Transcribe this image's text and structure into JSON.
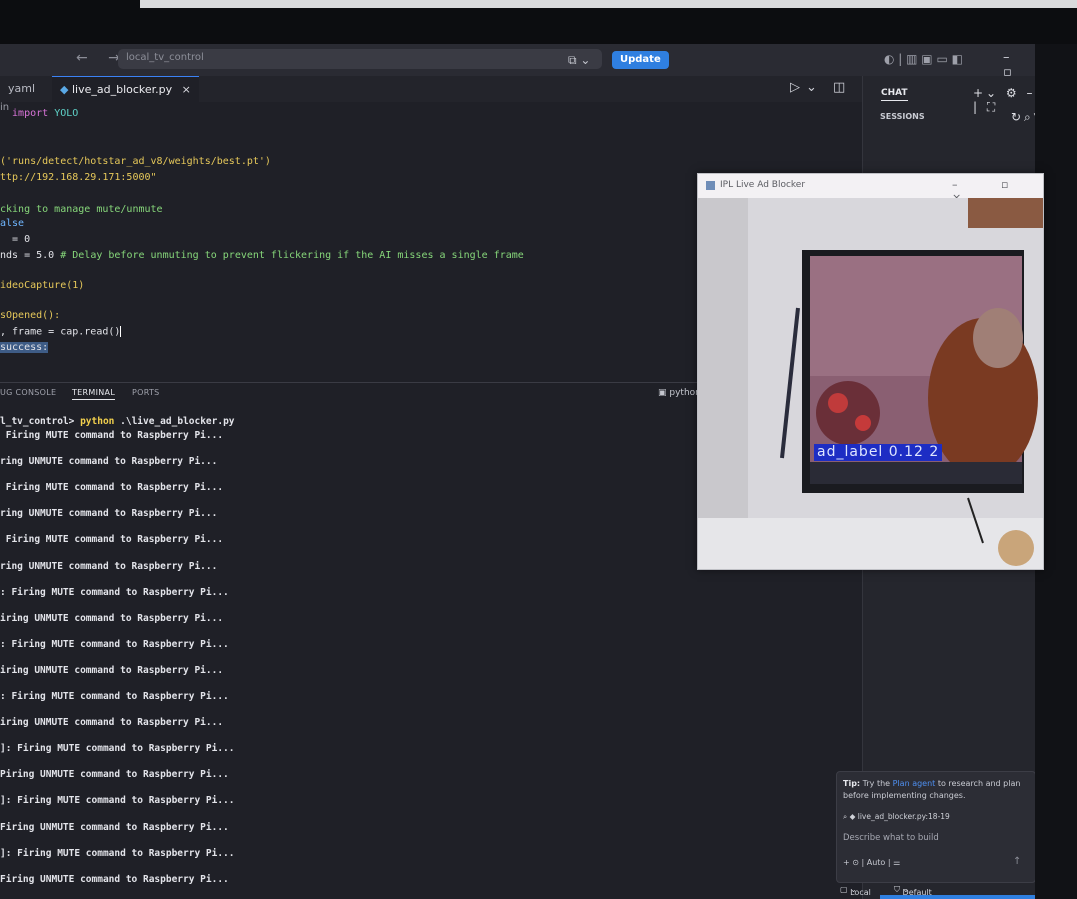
{
  "titlebar": {
    "search_text": "local_tv_control",
    "update_label": "Update"
  },
  "tabs": [
    {
      "label": "yaml"
    },
    {
      "label": "live_ad_blocker.py",
      "close": "×"
    }
  ],
  "breadcrumb": "in",
  "code_lines": [
    {
      "segments": [
        {
          "c": "kw",
          "t": "  import "
        },
        {
          "c": "cls",
          "t": "YOLO"
        }
      ]
    },
    {
      "segments": [
        {
          "c": "yel",
          "t": "('runs/detect/hotstar_ad_v8/weights/best.pt')"
        }
      ]
    },
    {
      "segments": [
        {
          "c": "yel",
          "t": "ttp://192.168.29.171:5000\""
        }
      ]
    },
    {
      "segments": [
        {
          "c": "grn",
          "t": "cking to manage mute/unmute"
        }
      ]
    },
    {
      "segments": [
        {
          "c": "blu",
          "t": "alse"
        }
      ]
    },
    {
      "segments": [
        {
          "c": "wht",
          "t": "  = 0"
        }
      ]
    },
    {
      "segments": [
        {
          "c": "wht",
          "t": "nds = 5.0 "
        },
        {
          "c": "grn",
          "t": "# Delay before unmuting to prevent flickering if the AI misses a single frame"
        }
      ]
    },
    {
      "segments": [
        {
          "c": "yel",
          "t": "ideoCapture(1)"
        }
      ]
    },
    {
      "segments": [
        {
          "c": "yel",
          "t": "sOpened():"
        }
      ]
    },
    {
      "segments": [
        {
          "c": "wht",
          "t": ", frame = cap.read()"
        }
      ]
    },
    {
      "segments": [
        {
          "c": "sel",
          "t": "success:"
        }
      ]
    }
  ],
  "panel": {
    "tabs": [
      "UG CONSOLE",
      "TERMINAL",
      "PORTS"
    ],
    "active_tab": "TERMINAL",
    "shell_label": "python"
  },
  "terminal": {
    "prompt_path": "l_tv_control> ",
    "prompt_cmd": "python",
    "prompt_args": " .\\live_ad_blocker.py",
    "lines": [
      " Firing MUTE command to Raspberry Pi...",
      "ring UNMUTE command to Raspberry Pi...",
      " Firing MUTE command to Raspberry Pi...",
      "ring UNMUTE command to Raspberry Pi...",
      " Firing MUTE command to Raspberry Pi...",
      "ring UNMUTE command to Raspberry Pi...",
      ": Firing MUTE command to Raspberry Pi...",
      "iring UNMUTE command to Raspberry Pi...",
      ": Firing MUTE command to Raspberry Pi...",
      "iring UNMUTE command to Raspberry Pi...",
      ": Firing MUTE command to Raspberry Pi...",
      "iring UNMUTE command to Raspberry Pi...",
      "]: Firing MUTE command to Raspberry Pi...",
      "Piring UNMUTE command to Raspberry Pi...",
      "]: Firing MUTE command to Raspberry Pi...",
      "Firing UNMUTE command to Raspberry Pi...",
      "]: Firing MUTE command to Raspberry Pi...",
      "Firing UNMUTE command to Raspberry Pi...",
      "]: Firing MUTE command to Raspberry Pi..."
    ]
  },
  "sidebar": {
    "chat_label": "CHAT",
    "sessions_label": "SESSIONS",
    "tip_prefix": "Tip:",
    "tip_mid1": " Try the ",
    "tip_link": "Plan agent",
    "tip_rest": " to research and plan before implementing changes.",
    "context_chip": "live_ad_blocker.py:18-19",
    "input_placeholder": "Describe what to build",
    "mode_label": "Auto",
    "status_local": "Local",
    "status_approvals": "Default Approvals"
  },
  "ad_window": {
    "title": "IPL Live Ad Blocker",
    "detection_label": "ad_label 0.12 2"
  },
  "colors": {
    "accent": "#2f7fe0",
    "detection_box": "#1d2dc4"
  }
}
